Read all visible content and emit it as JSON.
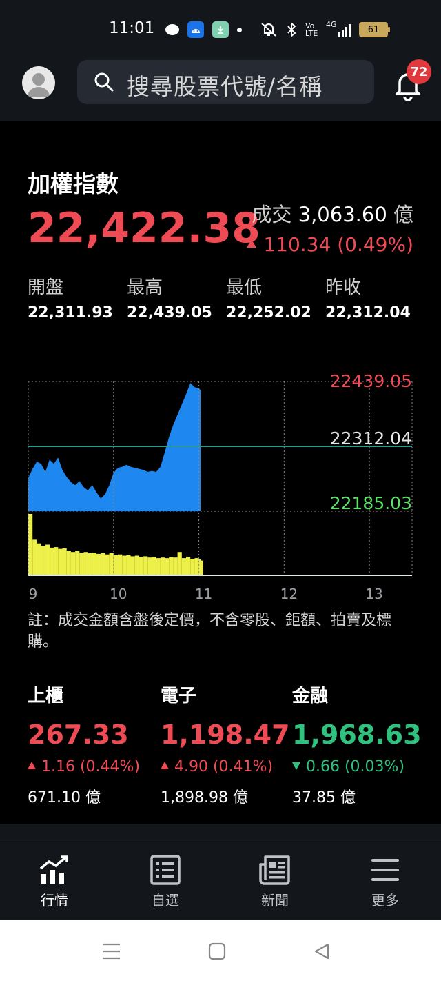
{
  "status_bar": {
    "time": "11:01",
    "network": "4G",
    "volte": "Vo LTE",
    "battery": "61"
  },
  "header": {
    "search_placeholder": "搜尋股票代號/名稱",
    "notification_count": "72"
  },
  "index": {
    "name": "加權指數",
    "price": "22,422.38",
    "volume_label": "成交",
    "volume_value": "3,063.60",
    "volume_unit": "億",
    "change": "110.34 (0.49%)",
    "stats": [
      {
        "label": "開盤",
        "value": "22,311.93"
      },
      {
        "label": "最高",
        "value": "22,439.05"
      },
      {
        "label": "最低",
        "value": "22,252.02"
      },
      {
        "label": "昨收",
        "value": "22,312.04"
      }
    ]
  },
  "chart_data": {
    "type": "area",
    "y_labels": {
      "high": "22439.05",
      "prev_close": "22312.04",
      "low": "22185.03"
    },
    "ylim": [
      22185.03,
      22439.05
    ],
    "x_ticks": [
      "9",
      "10",
      "11",
      "12",
      "13"
    ],
    "x_range": [
      9,
      13.5
    ],
    "series": [
      {
        "values": [
          [
            9.0,
            22250
          ],
          [
            9.05,
            22268
          ],
          [
            9.1,
            22282
          ],
          [
            9.15,
            22278
          ],
          [
            9.2,
            22262
          ],
          [
            9.25,
            22286
          ],
          [
            9.3,
            22278
          ],
          [
            9.35,
            22290
          ],
          [
            9.4,
            22266
          ],
          [
            9.45,
            22252
          ],
          [
            9.5,
            22242
          ],
          [
            9.55,
            22236
          ],
          [
            9.6,
            22244
          ],
          [
            9.65,
            22232
          ],
          [
            9.7,
            22226
          ],
          [
            9.75,
            22236
          ],
          [
            9.8,
            22222
          ],
          [
            9.85,
            22210
          ],
          [
            9.9,
            22218
          ],
          [
            9.95,
            22236
          ],
          [
            10.0,
            22260
          ],
          [
            10.05,
            22270
          ],
          [
            10.1,
            22272
          ],
          [
            10.15,
            22276
          ],
          [
            10.2,
            22272
          ],
          [
            10.25,
            22270
          ],
          [
            10.3,
            22268
          ],
          [
            10.35,
            22266
          ],
          [
            10.4,
            22262
          ],
          [
            10.45,
            22264
          ],
          [
            10.5,
            22262
          ],
          [
            10.55,
            22272
          ],
          [
            10.6,
            22300
          ],
          [
            10.65,
            22330
          ],
          [
            10.7,
            22354
          ],
          [
            10.75,
            22374
          ],
          [
            10.8,
            22394
          ],
          [
            10.85,
            22414
          ],
          [
            10.9,
            22436
          ],
          [
            10.95,
            22428
          ],
          [
            11.0,
            22426
          ],
          [
            11.02,
            22422
          ]
        ]
      },
      {
        "name": "成交量",
        "values": [
          [
            9.0,
            100
          ],
          [
            9.05,
            58
          ],
          [
            9.1,
            52
          ],
          [
            9.15,
            48
          ],
          [
            9.2,
            50
          ],
          [
            9.25,
            45
          ],
          [
            9.3,
            46
          ],
          [
            9.35,
            43
          ],
          [
            9.4,
            44
          ],
          [
            9.45,
            40
          ],
          [
            9.5,
            38
          ],
          [
            9.55,
            40
          ],
          [
            9.6,
            37
          ],
          [
            9.65,
            38
          ],
          [
            9.7,
            36
          ],
          [
            9.75,
            37
          ],
          [
            9.8,
            35
          ],
          [
            9.85,
            36
          ],
          [
            9.9,
            34
          ],
          [
            9.95,
            36
          ],
          [
            10.0,
            33
          ],
          [
            10.05,
            34
          ],
          [
            10.1,
            32
          ],
          [
            10.15,
            33
          ],
          [
            10.2,
            31
          ],
          [
            10.25,
            32
          ],
          [
            10.3,
            30
          ],
          [
            10.35,
            31
          ],
          [
            10.4,
            29
          ],
          [
            10.45,
            30
          ],
          [
            10.5,
            28
          ],
          [
            10.55,
            29
          ],
          [
            10.6,
            28
          ],
          [
            10.65,
            30
          ],
          [
            10.7,
            29
          ],
          [
            10.75,
            38
          ],
          [
            10.8,
            28
          ],
          [
            10.85,
            30
          ],
          [
            10.9,
            27
          ],
          [
            10.95,
            28
          ],
          [
            11.0,
            26
          ],
          [
            11.02,
            24
          ]
        ]
      }
    ]
  },
  "note": "註：成交金額含盤後定價，不含零股、鉅額、拍賣及標購。",
  "sectors": [
    {
      "name": "上櫃",
      "price": "267.33",
      "change": "1.16 (0.44%)",
      "direction": "up",
      "amount": "671.10 億"
    },
    {
      "name": "電子",
      "price": "1,198.47",
      "change": "4.90 (0.41%)",
      "direction": "up",
      "amount": "1,898.98 億"
    },
    {
      "name": "金融",
      "price": "1,968.63",
      "change": "0.66 (0.03%)",
      "direction": "down",
      "amount": "37.85 億"
    }
  ],
  "colors": {
    "up": "#ef4b55",
    "down": "#2ec27e",
    "price_area": "#1e88f0",
    "volume_bars": "#eef04a",
    "prev_close_line": "#2a9a8c"
  },
  "tabs": [
    {
      "label": "行情",
      "icon": "chart-up-icon",
      "active": true
    },
    {
      "label": "自選",
      "icon": "list-icon",
      "active": false
    },
    {
      "label": "新聞",
      "icon": "news-icon",
      "active": false
    },
    {
      "label": "更多",
      "icon": "menu-icon",
      "active": false
    }
  ]
}
